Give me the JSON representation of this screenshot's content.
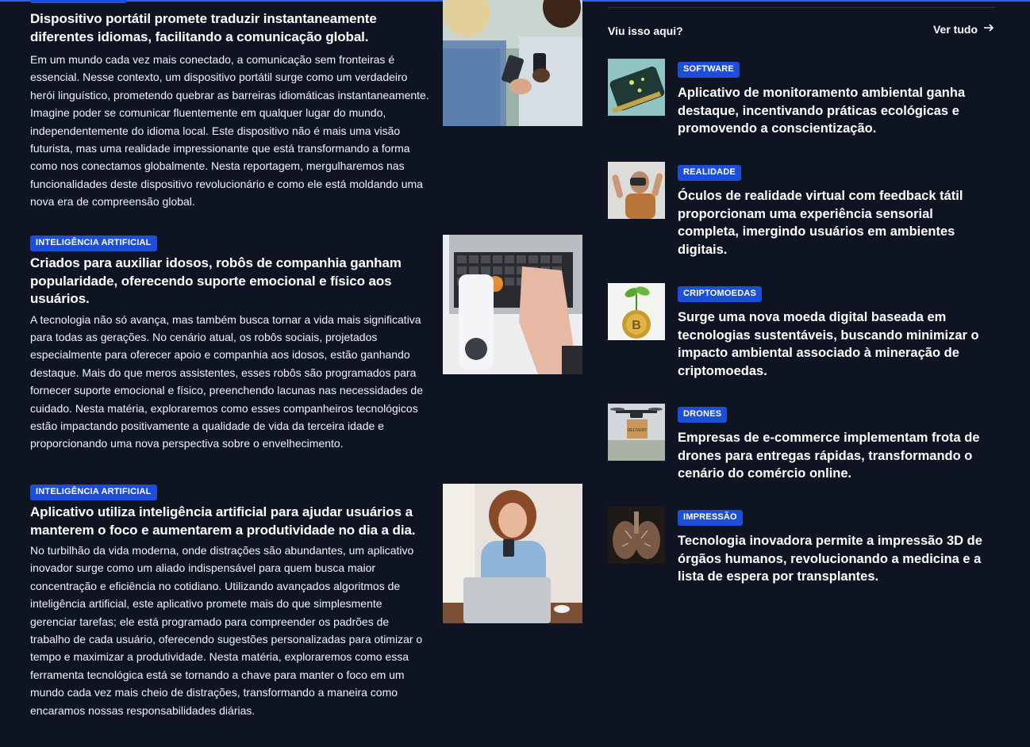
{
  "articles": [
    {
      "category": "",
      "title": "Dispositivo portátil promete traduzir instantaneamente diferentes idiomas, facilitando a comunicação global.",
      "body": "Em um mundo cada vez mais conectado, a comunicação sem fronteiras é essencial. Nesse contexto, um dispositivo portátil surge como um verdadeiro herói linguístico, prometendo quebrar as barreiras idiomáticas instantaneamente. Imagine poder se comunicar fluentemente em qualquer lugar do mundo, independentemente do idioma local. Este dispositivo não é mais uma visão futurista, mas uma realidade impressionante que está transformando a forma como nos conectamos globalmente. Nesta reportagem, mergulharemos nas funcionalidades deste dispositivo revolucionário e como ele está moldando uma nova era de compreensão global."
    },
    {
      "category": "INTELIGÊNCIA ARTIFICIAL",
      "title": "Criados para auxiliar idosos, robôs de companhia ganham popularidade, oferecendo suporte emocional e físico aos usuários.",
      "body": "A tecnologia não só avança, mas também busca tornar a vida mais significativa para todas as gerações. No cenário atual, os robôs sociais, projetados especialmente para oferecer apoio e companhia aos idosos, estão ganhando destaque. Mais do que meros assistentes, esses robôs são programados para fornecer suporte emocional e físico, preenchendo lacunas nas necessidades de cuidado. Nesta matéria, exploraremos como esses companheiros tecnológicos estão impactando positivamente a qualidade de vida da terceira idade e proporcionando uma nova perspectiva sobre o envelhecimento."
    },
    {
      "category": "INTELIGÊNCIA ARTIFICIAL",
      "title": "Aplicativo utiliza inteligência artificial para ajudar usuários a manterem o foco e aumentarem a produtividade no dia a dia.",
      "body": "No turbilhão da vida moderna, onde distrações são abundantes, um aplicativo inovador surge como um aliado indispensável para quem busca maior concentração e eficiência no cotidiano. Utilizando avançados algoritmos de inteligência artificial, este aplicativo promete mais do que simplesmente gerenciar tarefas; ele está programado para compreender os padrões de trabalho de cada usuário, oferecendo sugestões personalizadas para otimizar o tempo e maximizar a produtividade. Nesta matéria, exploraremos como essa ferramenta tecnológica está se tornando a chave para manter o foco em um mundo cada vez mais cheio de distrações, transformando a maneira como encaramos nossas responsabilidades diárias."
    }
  ],
  "sidebar": {
    "heading": "Viu isso aqui?",
    "see_all": "Ver tudo",
    "items": [
      {
        "category": "SOFTWARE",
        "title": "Aplicativo de monitoramento ambiental ganha destaque, incentivando práticas ecológicas e promovendo a conscientização."
      },
      {
        "category": "REALIDADE",
        "title": "Óculos de realidade virtual com feedback tátil proporcionam uma experiência sensorial completa, imergindo usuários em ambientes digitais."
      },
      {
        "category": "CRIPTOMOEDAS",
        "title": "Surge uma nova moeda digital baseada em tecnologias sustentáveis, buscando minimizar o impacto ambiental associado à mineração de criptomoedas."
      },
      {
        "category": "DRONES",
        "title": "Empresas de e-commerce implementam frota de drones para entregas rápidas, transformando o cenário do comércio online."
      },
      {
        "category": "IMPRESSÃO",
        "title": "Tecnologia inovadora permite a impressão 3D de órgãos humanos, revolucionando a medicina e a lista de espera por transplantes."
      }
    ],
    "drone_box_text": "DELIVERY"
  },
  "colors": {
    "background": "#0f1423",
    "badge": "#1d4ed8",
    "accent_line": "#2563eb"
  }
}
